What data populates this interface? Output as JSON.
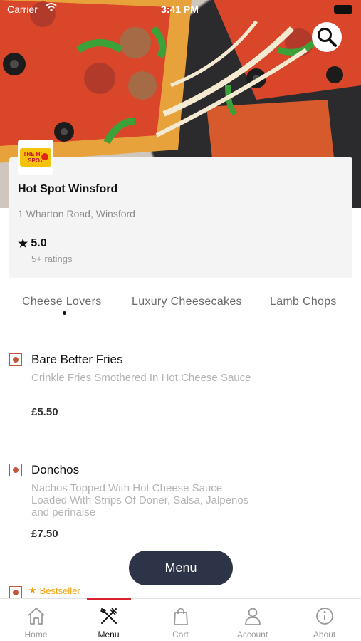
{
  "status_bar": {
    "carrier": "Carrier",
    "time": "3:41 PM"
  },
  "restaurant": {
    "logo_text": "THE HOT SPOT",
    "name": "Hot Spot Winsford",
    "address": "1 Wharton Road, Winsford",
    "rating": "5.0",
    "rating_count": "5+ ratings"
  },
  "categories": [
    {
      "label": "Cheese  Lovers",
      "active": true
    },
    {
      "label": "Luxury Cheesecakes",
      "active": false
    },
    {
      "label": "Lamb Chops",
      "active": false
    }
  ],
  "menu_items": [
    {
      "name": "Bare Better Fries",
      "description": "Crinkle Fries Smothered In Hot Cheese Sauce",
      "price": "£5.50"
    },
    {
      "name": "Donchos",
      "description": "Nachos Topped With Hot Cheese Sauce Loaded With Strips Of Doner, Salsa, Jalpenos and perinaise",
      "price": "£7.50"
    }
  ],
  "next_item_badge": "Bestseller",
  "floating_button": {
    "label": "Menu"
  },
  "bottom_nav": [
    {
      "label": "Home",
      "icon": "home-icon",
      "active": false
    },
    {
      "label": "Menu",
      "icon": "fork-knife-icon",
      "active": true
    },
    {
      "label": "Cart",
      "icon": "bag-icon",
      "active": false
    },
    {
      "label": "Account",
      "icon": "person-icon",
      "active": false
    },
    {
      "label": "About",
      "icon": "info-icon",
      "active": false
    }
  ],
  "colors": {
    "accent": "#d8202e",
    "fab": "#2e3447",
    "veg_marker": "#c0563a",
    "bestseller": "#f5a10a"
  }
}
